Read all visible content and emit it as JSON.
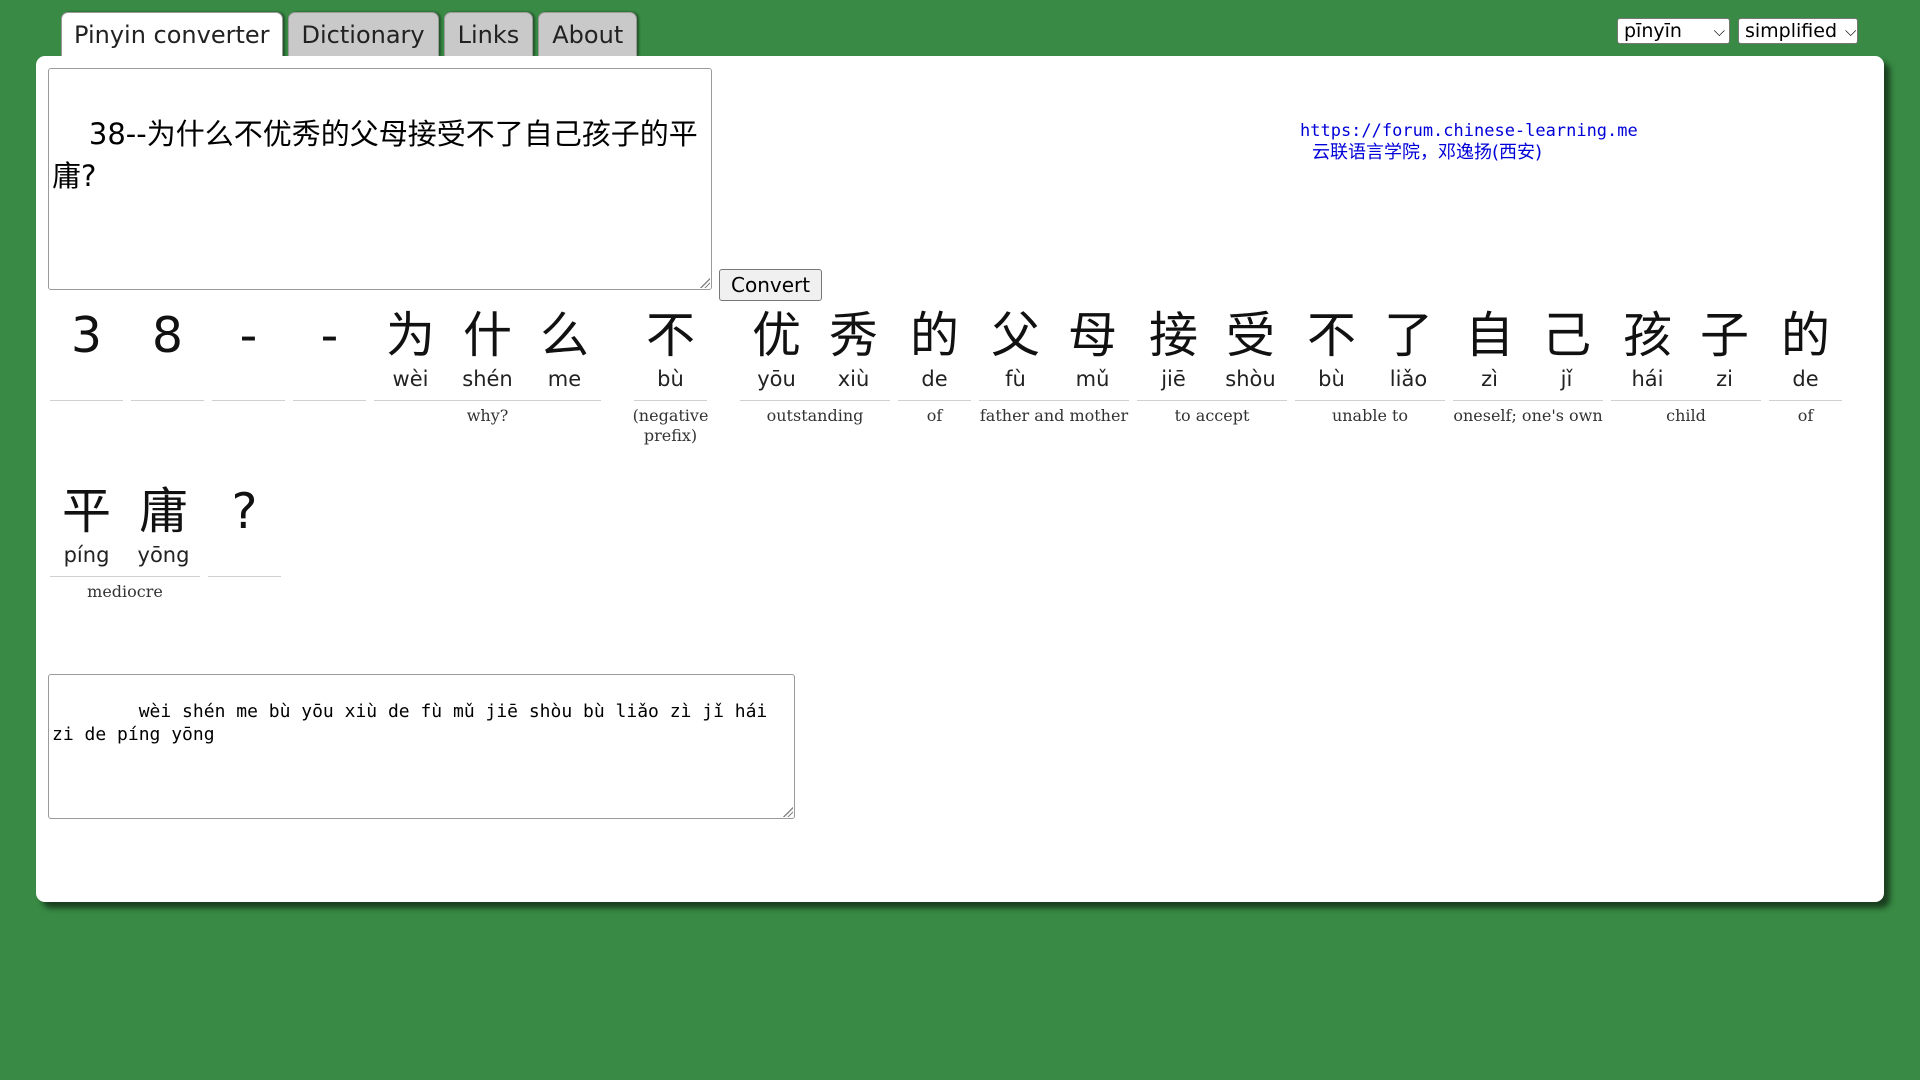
{
  "tabs": [
    {
      "label": "Pinyin converter",
      "active": true
    },
    {
      "label": "Dictionary",
      "active": false
    },
    {
      "label": "Links",
      "active": false
    },
    {
      "label": "About",
      "active": false
    }
  ],
  "selects": {
    "tone_format": "pīnyīn",
    "script": "simplified"
  },
  "input_text": "38--为什么不优秀的父母接受不了自己孩子的平庸?",
  "convert_label": "Convert",
  "credit": {
    "url": "https://forum.chinese-learning.me",
    "name": "云联语言学院，邓逸扬(西安)"
  },
  "words": [
    {
      "chars": [
        {
          "hz": "3",
          "py": ""
        }
      ],
      "def": ""
    },
    {
      "chars": [
        {
          "hz": "8",
          "py": ""
        }
      ],
      "def": ""
    },
    {
      "chars": [
        {
          "hz": "-",
          "py": ""
        }
      ],
      "def": ""
    },
    {
      "chars": [
        {
          "hz": "-",
          "py": ""
        }
      ],
      "def": ""
    },
    {
      "chars": [
        {
          "hz": "为",
          "py": "wèi"
        },
        {
          "hz": "什",
          "py": "shén"
        },
        {
          "hz": "么",
          "py": "me"
        }
      ],
      "def": "why?"
    },
    {
      "chars": [
        {
          "hz": "不",
          "py": "bù"
        }
      ],
      "def": "(negative prefix)"
    },
    {
      "chars": [
        {
          "hz": "优",
          "py": "yōu"
        },
        {
          "hz": "秀",
          "py": "xiù"
        }
      ],
      "def": "outstanding"
    },
    {
      "chars": [
        {
          "hz": "的",
          "py": "de"
        }
      ],
      "def": "of"
    },
    {
      "chars": [
        {
          "hz": "父",
          "py": "fù"
        },
        {
          "hz": "母",
          "py": "mǔ"
        }
      ],
      "def": "father and mother"
    },
    {
      "chars": [
        {
          "hz": "接",
          "py": "jiē"
        },
        {
          "hz": "受",
          "py": "shòu"
        }
      ],
      "def": "to accept"
    },
    {
      "chars": [
        {
          "hz": "不",
          "py": "bù"
        },
        {
          "hz": "了",
          "py": "liǎo"
        }
      ],
      "def": "unable to"
    },
    {
      "chars": [
        {
          "hz": "自",
          "py": "zì"
        },
        {
          "hz": "己",
          "py": "jǐ"
        }
      ],
      "def": "oneself; one's own"
    },
    {
      "chars": [
        {
          "hz": "孩",
          "py": "hái"
        },
        {
          "hz": "子",
          "py": "zi"
        }
      ],
      "def": "child"
    },
    {
      "chars": [
        {
          "hz": "的",
          "py": "de"
        }
      ],
      "def": "of"
    },
    {
      "chars": [
        {
          "hz": "平",
          "py": "píng"
        },
        {
          "hz": "庸",
          "py": "yōng"
        }
      ],
      "def": "mediocre"
    },
    {
      "chars": [
        {
          "hz": "?",
          "py": ""
        }
      ],
      "def": ""
    }
  ],
  "output_text": "    wèi shén me bù yōu xiù de fù mǔ jiē shòu bù liǎo zì jǐ hái zi de píng yōng"
}
